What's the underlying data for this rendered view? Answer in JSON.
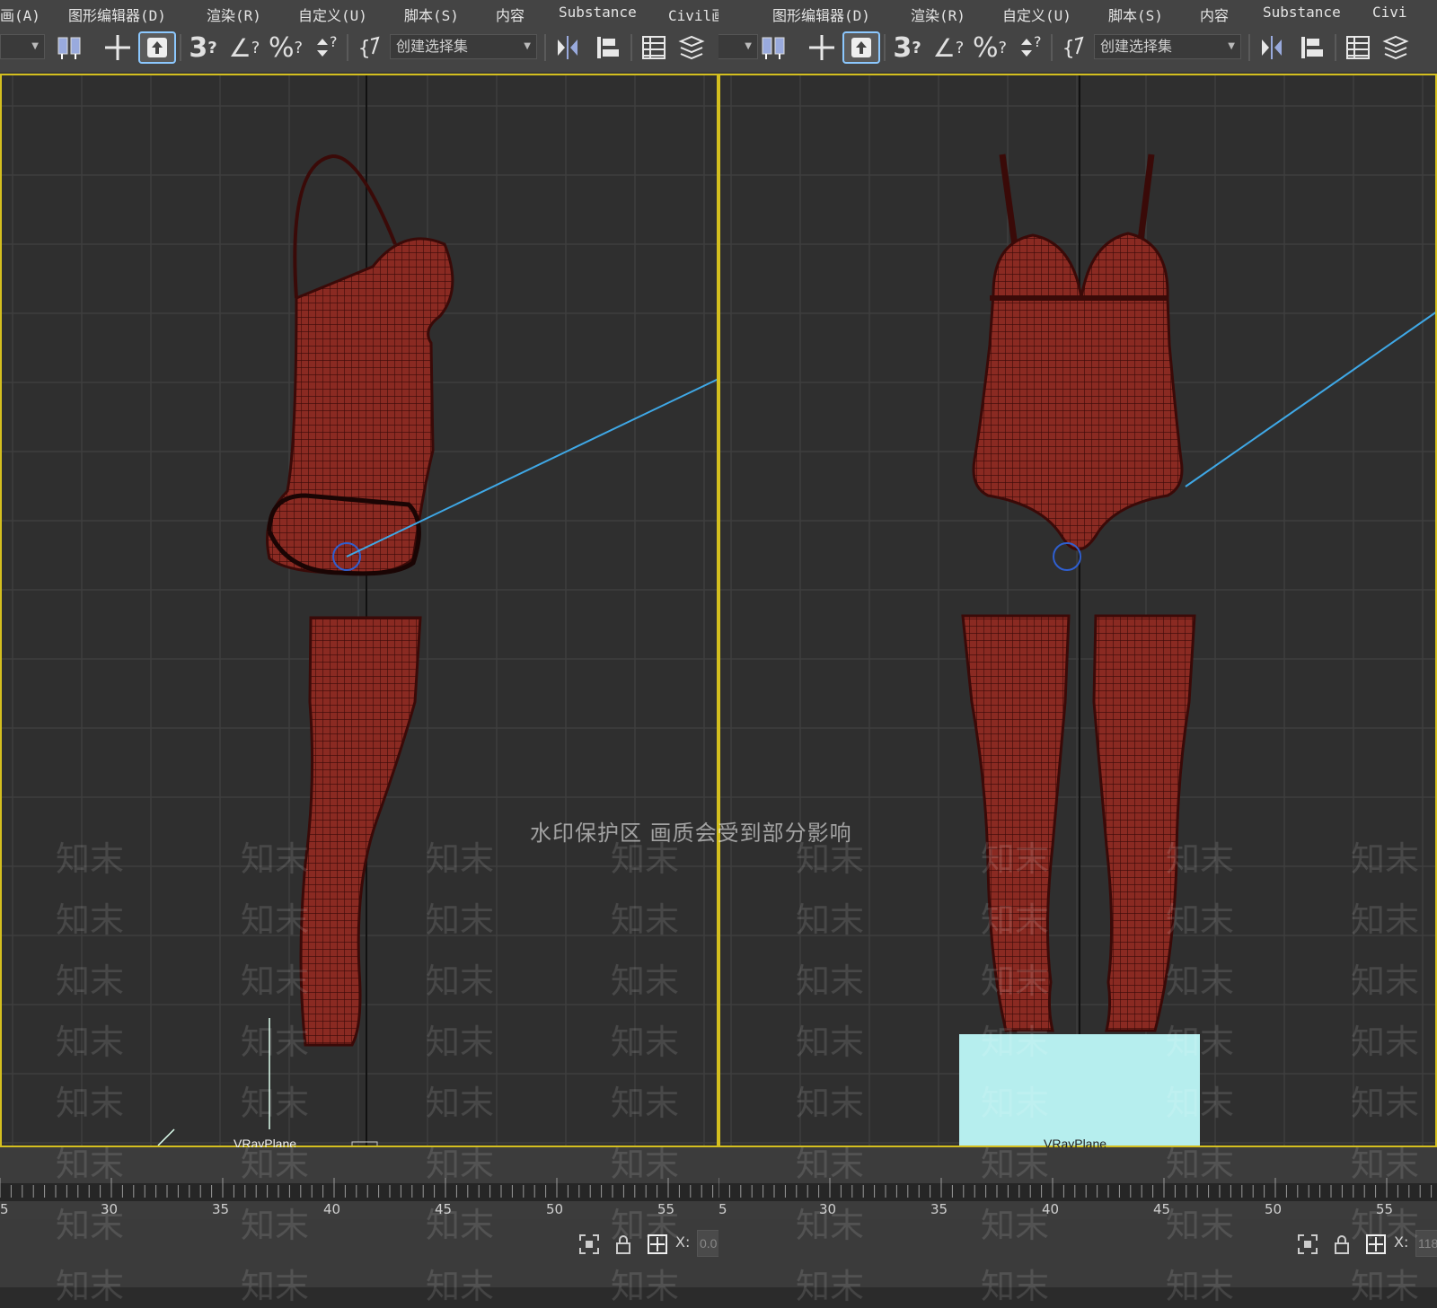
{
  "menu": {
    "left": [
      "画(A)",
      "图形编辑器(D)",
      "渲染(R)",
      "自定义(U)",
      "脚本(S)",
      "内容",
      "Substance",
      "Civil画(A)"
    ],
    "right": [
      "图形编辑器(D)",
      "渲染(R)",
      "自定义(U)",
      "脚本(S)",
      "内容",
      "Substance",
      "Civi"
    ]
  },
  "toolbar": {
    "selection_set_placeholder": "创建选择集",
    "snap_3d_label": "3",
    "angle_snap_label": "∠",
    "percent_snap_label": "%"
  },
  "viewport": {
    "object_label": "VRayPlane",
    "watermark_notice": "水印保护区  画质会受到部分影响",
    "watermark_brand": "知末"
  },
  "timeline": {
    "ticks": [
      "5",
      "30",
      "35",
      "40",
      "45",
      "50",
      "55",
      "5",
      "30",
      "35",
      "40",
      "45",
      "50",
      "55"
    ]
  },
  "status": {
    "x_label": "X:",
    "x_value_left": "0.0",
    "x_value_right": "118"
  },
  "colors": {
    "mesh": "#8a2a22",
    "mesh_line": "#3a0a08",
    "active_border": "#d4bf1f",
    "plane": "#b6eeee",
    "camera_line": "#3fa8e6"
  }
}
